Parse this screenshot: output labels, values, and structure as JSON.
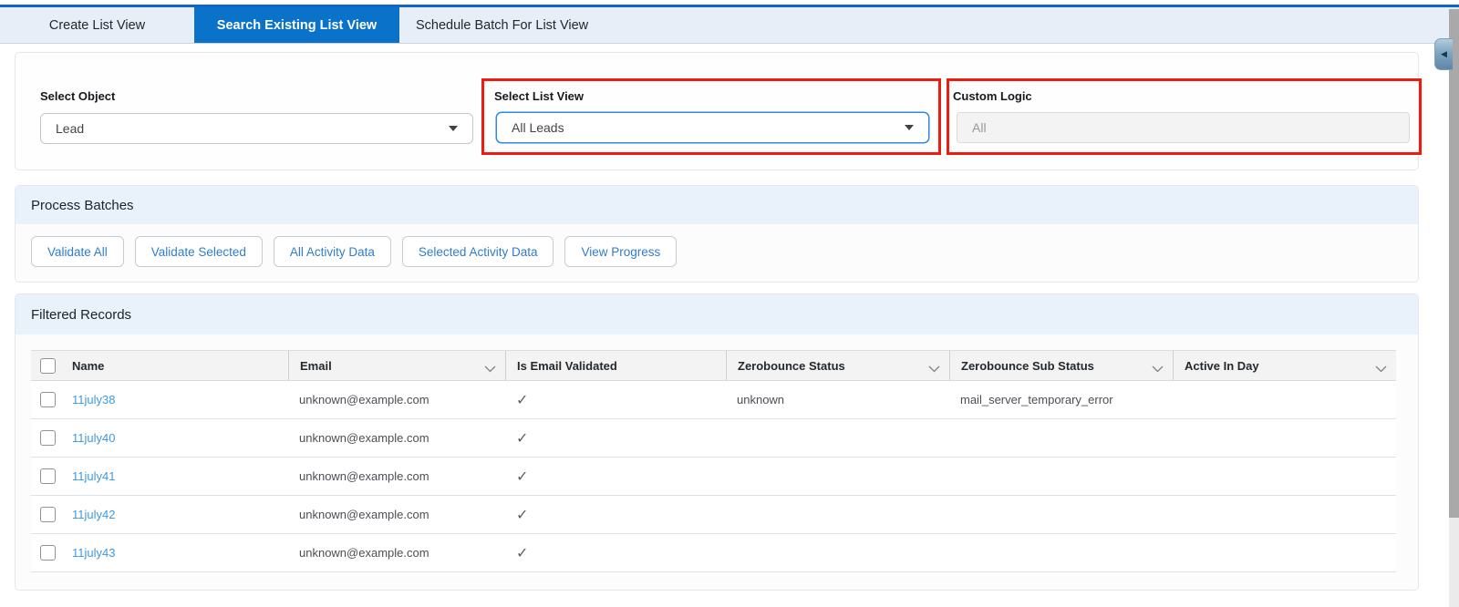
{
  "colors": {
    "accent_blue": "#0b72c9",
    "top_line_blue": "#0d66d0",
    "tab_bar_bg": "#e8eef7",
    "section_header_bg": "#e9f1fb",
    "annotation_red": "#ed1c0f",
    "link_blue": "#3f99e0",
    "button_text_blue": "#2f7dcb",
    "card_bg": "#fcfcfd"
  },
  "tabs": [
    {
      "label": "Create List View",
      "active": false
    },
    {
      "label": "Search Existing List View",
      "active": true
    },
    {
      "label": "Schedule Batch For List View",
      "active": false
    }
  ],
  "form": {
    "select_object": {
      "label": "Select Object",
      "value": "Lead"
    },
    "select_list_view": {
      "label": "Select List View",
      "value": "All Leads"
    },
    "custom_logic": {
      "label": "Custom Logic",
      "value": "All"
    }
  },
  "process_batches": {
    "title": "Process Batches",
    "buttons": [
      {
        "label": "Validate All"
      },
      {
        "label": "Validate Selected"
      },
      {
        "label": "All Activity Data"
      },
      {
        "label": "Selected Activity Data"
      },
      {
        "label": "View Progress"
      }
    ]
  },
  "filtered_records": {
    "title": "Filtered Records",
    "columns": [
      {
        "label": "Name",
        "sortable": false
      },
      {
        "label": "Email",
        "sortable": true
      },
      {
        "label": "Is Email Validated",
        "sortable": false
      },
      {
        "label": "Zerobounce Status",
        "sortable": true
      },
      {
        "label": "Zerobounce Sub Status",
        "sortable": true
      },
      {
        "label": "Active In Day",
        "sortable": true
      }
    ],
    "rows": [
      {
        "name": "11july38",
        "email": "unknown@example.com",
        "is_email_validated": "✓",
        "zerobounce_status": "unknown",
        "zerobounce_sub_status": "mail_server_temporary_error",
        "active_in_day": ""
      },
      {
        "name": "11july40",
        "email": "unknown@example.com",
        "is_email_validated": "✓",
        "zerobounce_status": "",
        "zerobounce_sub_status": "",
        "active_in_day": ""
      },
      {
        "name": "11july41",
        "email": "unknown@example.com",
        "is_email_validated": "✓",
        "zerobounce_status": "",
        "zerobounce_sub_status": "",
        "active_in_day": ""
      },
      {
        "name": "11july42",
        "email": "unknown@example.com",
        "is_email_validated": "✓",
        "zerobounce_status": "",
        "zerobounce_sub_status": "",
        "active_in_day": ""
      },
      {
        "name": "11july43",
        "email": "unknown@example.com",
        "is_email_validated": "✓",
        "zerobounce_status": "",
        "zerobounce_sub_status": "",
        "active_in_day": ""
      }
    ]
  },
  "glyphs": {
    "collapse_left_arrow": "◀"
  }
}
